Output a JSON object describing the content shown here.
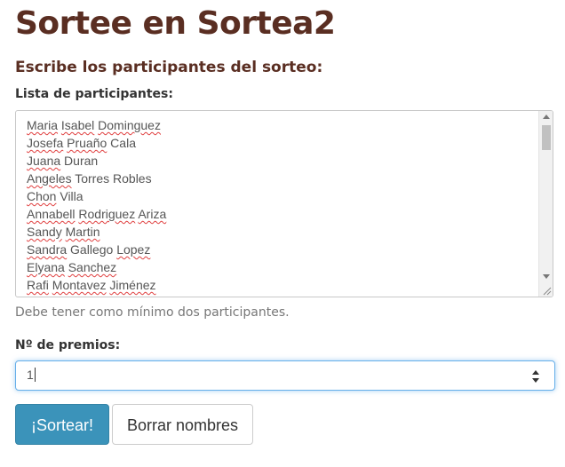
{
  "title": "Sortee en Sortea2",
  "subtitle": "Escribe los participantes del sorteo:",
  "participants_label": "Lista de participantes:",
  "participants": [
    "Maria Isabel Dominguez",
    "Josefa Pruaño Cala",
    "Juana Duran",
    "Angeles Torres Robles",
    "Chon Villa",
    "Annabell Rodriguez Ariza",
    "Sandy Martin",
    "Sandra Gallego Lopez",
    "Elyana Sanchez",
    "Rafi Montavez Jiménez"
  ],
  "help_text": "Debe tener como mínimo dos participantes.",
  "prizes_label": "Nº de premios:",
  "prizes_value": "1",
  "buttons": {
    "draw": "¡Sortear!",
    "clear": "Borrar nombres"
  },
  "icons": {
    "scroll_up": "scroll-up-arrow-icon",
    "scroll_down": "scroll-down-arrow-icon",
    "resize": "resize-grip-icon",
    "spinner_up": "spinner-up-icon",
    "spinner_down": "spinner-down-icon"
  },
  "colors": {
    "title": "#5a2e22",
    "primary_button": "#3b93ba",
    "focus_border": "#66afe9"
  }
}
